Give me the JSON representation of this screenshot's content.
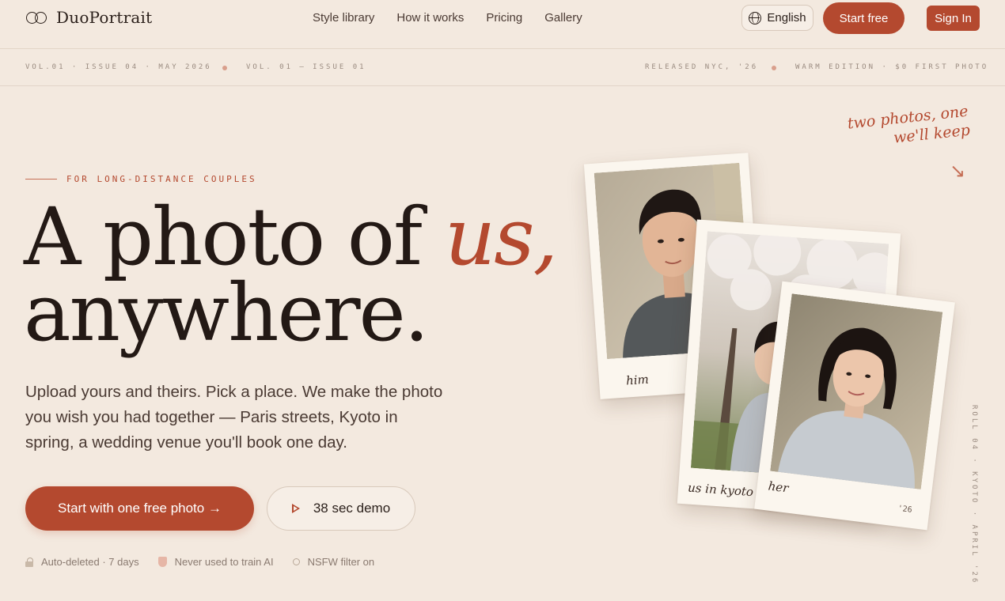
{
  "brand": {
    "name": "DuoPortrait"
  },
  "nav": {
    "links": [
      "Style library",
      "How it works",
      "Pricing",
      "Gallery"
    ],
    "language": "English",
    "start_free": "Start free",
    "sign_in": "Sign In"
  },
  "ticker": {
    "left_1": "VOL.01 · ISSUE 04 · MAY 2026",
    "left_2": "VOL. 01 — ISSUE 01",
    "right_1": "RELEASED NYC, '26",
    "right_2": "WARM EDITION · $0 FIRST PHOTO"
  },
  "hero": {
    "eyebrow": "FOR LONG-DISTANCE COUPLES",
    "headline_1": "A photo of ",
    "headline_accent": "us,",
    "headline_2": "anywhere.",
    "subtitle": "Upload yours and theirs. Pick a place. We make the photo you wish you had together — Paris streets, Kyoto in spring, a wedding venue you'll book one day.",
    "cta_primary": "Start with one free photo →",
    "cta_secondary": "38 sec demo",
    "trust": [
      "Auto-deleted · 7 days",
      "Never used to train AI",
      "NSFW filter on"
    ]
  },
  "polaroids": {
    "tagline": "two photos, one we'll keep",
    "him": "him",
    "us": "us in kyoto",
    "her": "her",
    "year": "'26"
  },
  "roll_text": "ROLL 04 · KYOTO · APRIL '26",
  "colors": {
    "accent": "#b4492f",
    "background": "#f3e9df",
    "text": "#2a1f1a"
  }
}
